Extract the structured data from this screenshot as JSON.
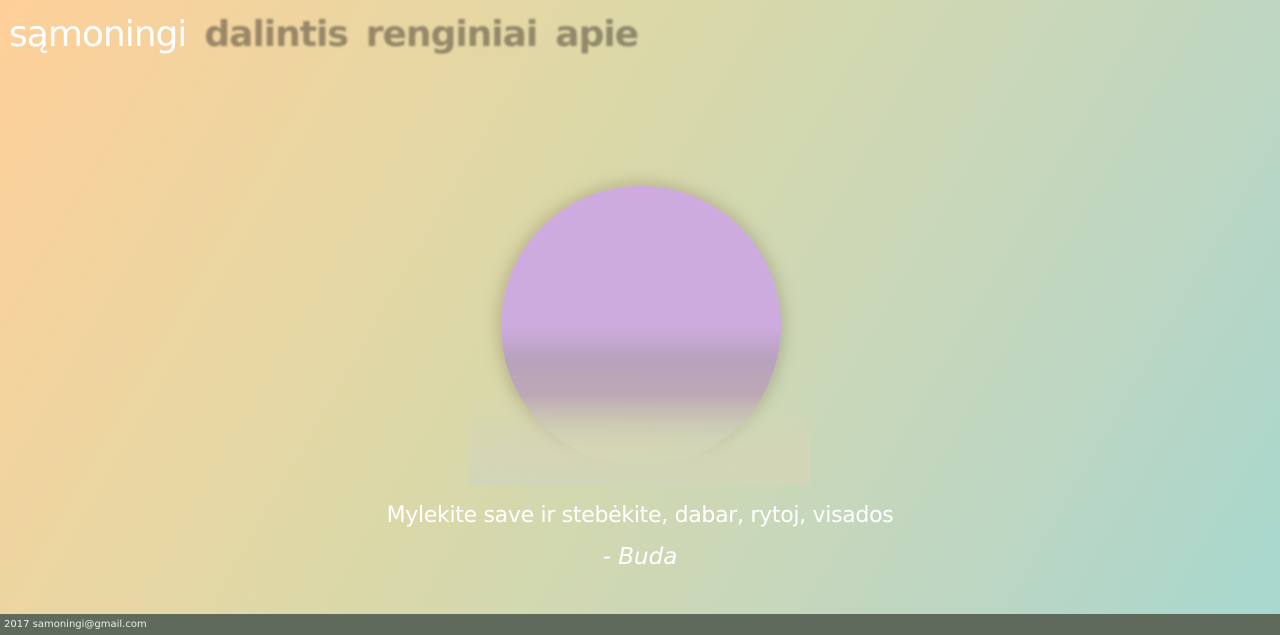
{
  "nav": {
    "brand": "sąmoningi",
    "items": [
      {
        "label": "dalintis"
      },
      {
        "label": "renginiai"
      },
      {
        "label": "apie"
      }
    ]
  },
  "hero": {
    "quote": "Mylekite save ir stebėkite, dabar, rytoj, visados",
    "author": "- Buda"
  },
  "footer": {
    "text": "2017 samoningi@gmail.com"
  },
  "colors": {
    "circle": "#cdabdf",
    "footer_bg": "#5f6a5d",
    "text": "#ffffff"
  }
}
